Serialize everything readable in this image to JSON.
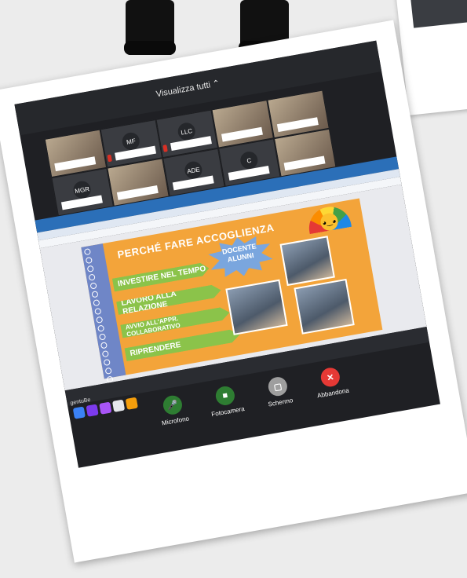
{
  "meeting": {
    "view_all_label": "Visualizza tutti",
    "participants": [
      "MF",
      "LLC",
      "ADE",
      "C",
      "MGR"
    ],
    "user_label": "gentuBe"
  },
  "slide": {
    "title": "PERCHÉ FARE ACCOGLIENZA",
    "burst_lines": [
      "DOCENTE",
      "ALUNNI"
    ],
    "items": [
      "INVESTIRE NEL TEMPO",
      "LAVORO ALLA RELAZIONE",
      "AVVIO ALL'APPR. COLLABORATIVO",
      "RIPRENDERE"
    ]
  },
  "controls": [
    {
      "label": "Microfono",
      "icon": "microphone-icon",
      "color": "#2e7d32",
      "glyph": "🎤"
    },
    {
      "label": "Fotocamera",
      "icon": "camera-icon",
      "color": "#2e7d32",
      "glyph": "■"
    },
    {
      "label": "Schermo",
      "icon": "screen-share-icon",
      "color": "#9e9e9e",
      "glyph": "▢"
    },
    {
      "label": "Abbandona",
      "icon": "close-icon",
      "color": "#e53935",
      "glyph": "✕"
    }
  ],
  "colors": {
    "slide_bg": "#f3a43a",
    "pill": "#8bc34a",
    "burst": "#7aa6de",
    "browser": "#2b6fb8"
  }
}
